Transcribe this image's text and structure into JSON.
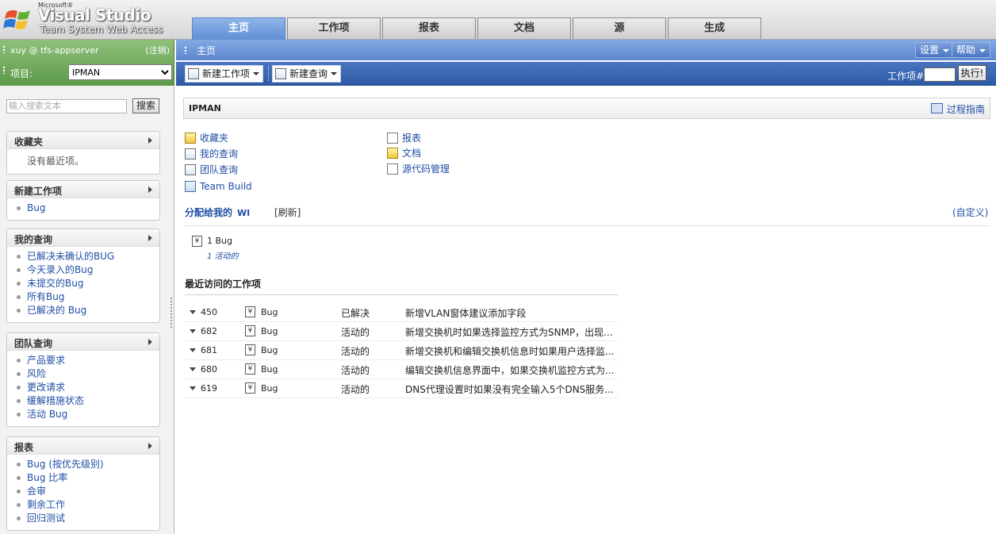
{
  "app": {
    "brand_small": "Microsoft®",
    "brand_title": "Visual Studio",
    "brand_sub": "Team System Web Access"
  },
  "tabs": [
    {
      "label": "主页",
      "active": true
    },
    {
      "label": "工作项",
      "active": false
    },
    {
      "label": "报表",
      "active": false
    },
    {
      "label": "文档",
      "active": false
    },
    {
      "label": "源",
      "active": false
    },
    {
      "label": "生成",
      "active": false
    }
  ],
  "left": {
    "user": "xuy @ tfs-appserver",
    "logout": "(注销)",
    "project_label": "项目:",
    "project_value": "IPMAN",
    "search_placeholder": "输入搜索文本",
    "search_button": "搜索",
    "favorites": {
      "title": "收藏夹",
      "empty": "没有最近项。"
    },
    "new_work_item": {
      "title": "新建工作项",
      "items": [
        "Bug"
      ]
    },
    "my_queries": {
      "title": "我的查询",
      "items": [
        "已解决未确认的BUG",
        "今天录入的Bug",
        "未提交的Bug",
        "所有Bug",
        "已解决的 Bug"
      ]
    },
    "team_queries": {
      "title": "团队查询",
      "items": [
        "产品要求",
        "风险",
        "更改请求",
        "缓解措施状态",
        "活动 Bug"
      ]
    },
    "reports": {
      "title": "报表",
      "items": [
        "Bug (按优先级别)",
        "Bug 比率",
        "会审",
        "剩余工作",
        "回归测试"
      ]
    }
  },
  "header": {
    "breadcrumb": "主页",
    "settings": "设置",
    "help": "帮助"
  },
  "toolbar": {
    "new_work_item": "新建工作项",
    "new_query": "新建查询",
    "work_item_label": "工作项#",
    "work_item_value": "",
    "execute": "执行!"
  },
  "main": {
    "project_title": "IPMAN",
    "process_guide": "过程指南",
    "links_left": [
      {
        "label": "收藏夹",
        "icon": "favorites-icon"
      },
      {
        "label": "我的查询",
        "icon": "query-icon"
      },
      {
        "label": "团队查询",
        "icon": "query-icon"
      },
      {
        "label": "Team Build",
        "icon": "build-icon"
      }
    ],
    "links_right": [
      {
        "label": "报表",
        "icon": "report-icon"
      },
      {
        "label": "文档",
        "icon": "documents-icon"
      },
      {
        "label": "源代码管理",
        "icon": "source-control-icon"
      }
    ],
    "assigned_title": "分配给我的",
    "assigned_wi": "WI",
    "refresh": "[刷新]",
    "customize": "(自定义)",
    "bug_summary": "1 Bug",
    "bug_active": "1 活动的",
    "recent_title": "最近访问的工作项",
    "recent_items": [
      {
        "id": "450",
        "type": "Bug",
        "state": "已解决",
        "title": "新增VLAN窗体建议添加字段"
      },
      {
        "id": "682",
        "type": "Bug",
        "state": "活动的",
        "title": "新增交换机时如果选择监控方式为SNMP，出现..."
      },
      {
        "id": "681",
        "type": "Bug",
        "state": "活动的",
        "title": "新增交换机和编辑交换机信息时如果用户选择监..."
      },
      {
        "id": "680",
        "type": "Bug",
        "state": "活动的",
        "title": "编辑交换机信息界面中，如果交换机监控方式为..."
      },
      {
        "id": "619",
        "type": "Bug",
        "state": "活动的",
        "title": "DNS代理设置时如果没有完全输入5个DNS服务..."
      }
    ]
  }
}
